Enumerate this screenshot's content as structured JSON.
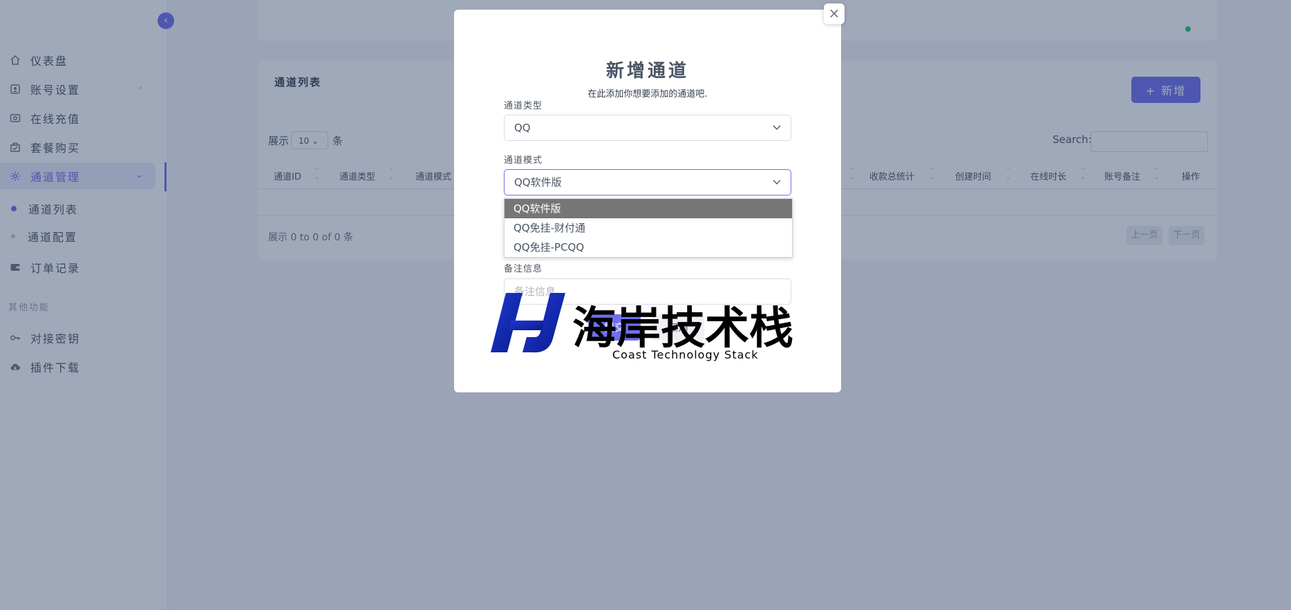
{
  "sidebar": {
    "items": [
      {
        "label": "仪表盘",
        "icon": "home-icon"
      },
      {
        "label": "账号设置",
        "icon": "account-icon"
      },
      {
        "label": "在线充值",
        "icon": "recharge-icon"
      },
      {
        "label": "套餐购买",
        "icon": "package-icon"
      },
      {
        "label": "通道管理",
        "icon": "gear-icon"
      },
      {
        "label": "订单记录",
        "icon": "wallet-icon"
      },
      {
        "label": "对接密钥",
        "icon": "key-icon"
      },
      {
        "label": "插件下载",
        "icon": "cloud-download-icon"
      }
    ],
    "sub_items": [
      {
        "label": "通道列表"
      },
      {
        "label": "通道配置"
      }
    ],
    "section_label": "其他功能"
  },
  "list_card": {
    "title": "通道列表",
    "add_button": "+ 新增",
    "length_prefix": "展示",
    "length_value": "10",
    "length_suffix": "条",
    "search_label": "Search:",
    "columns": [
      "通道ID",
      "通道类型",
      "通道模式",
      "收款总统计",
      "创建时间",
      "在线时长",
      "账号备注",
      "操作"
    ],
    "info": "展示 0 to 0 of 0 条",
    "prev": "上一页",
    "next": "下一页"
  },
  "modal": {
    "title": "新增通道",
    "subtitle": "在此添加你想要添加的通道吧.",
    "type_label": "通道类型",
    "type_value": "QQ",
    "mode_label": "通道模式",
    "mode_value": "QQ软件版",
    "mode_options": [
      "QQ软件版",
      "QQ免挂-财付通",
      "QQ免挂-PCQQ"
    ],
    "remark_label": "备注信息",
    "remark_placeholder": "备注信息",
    "submit": "提交",
    "cancel": "取消",
    "close": "×"
  },
  "watermark": {
    "logo_text": "海岸技术栈",
    "sub_text": "Coast Technology Stack"
  },
  "colors": {
    "accent": "#6f6ff0",
    "overlay": "#22385c",
    "status_online": "#28c76f"
  }
}
